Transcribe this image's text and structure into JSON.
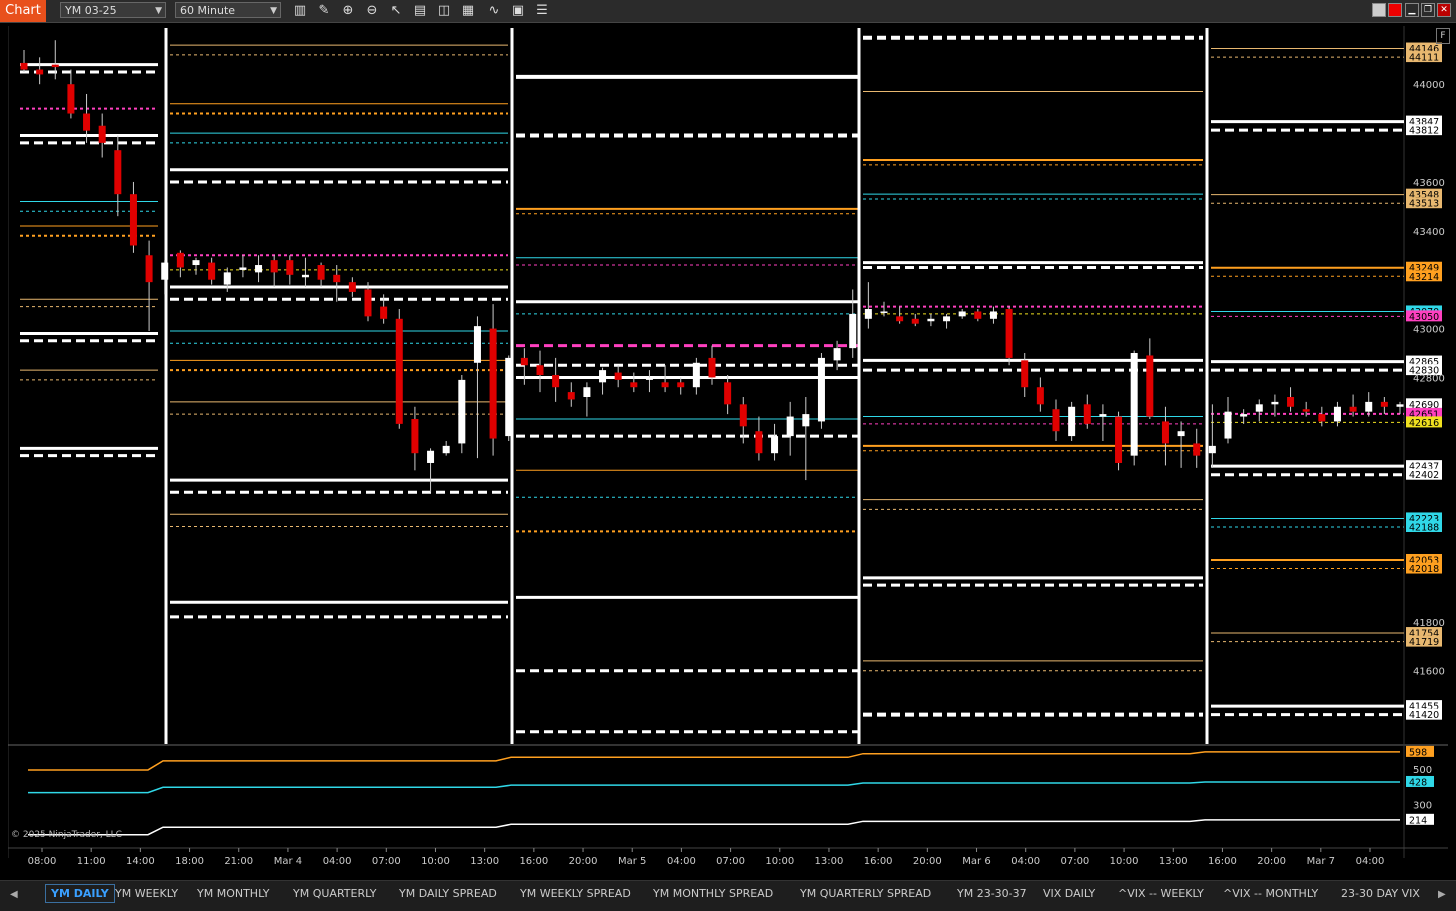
{
  "toolbar": {
    "chart_label": "Chart",
    "instrument": "YM 03-25",
    "interval": "60 Minute",
    "tools": [
      "bars-icon",
      "pencil-icon",
      "zoom-in-icon",
      "zoom-out-icon",
      "pointer-icon",
      "data-box-icon",
      "properties-icon",
      "templates-icon",
      "strategies-icon",
      "indicators-icon",
      "list-icon"
    ]
  },
  "panel_button": "F",
  "copyright": "© 2025 NinjaTrader, LLC",
  "chart_data": {
    "type": "candlestick",
    "instrument": "YM 03-25",
    "interval": "60 Minute",
    "ylim": [
      41300,
      44230
    ],
    "y_ticks": [
      44000,
      43600,
      43400,
      43000,
      42800,
      41800,
      41600
    ],
    "x_ticks": [
      "08:00",
      "11:00",
      "14:00",
      "18:00",
      "21:00",
      "Mar 4",
      "04:00",
      "07:00",
      "10:00",
      "13:00",
      "16:00",
      "20:00",
      "Mar 5",
      "04:00",
      "07:00",
      "10:00",
      "13:00",
      "16:00",
      "20:00",
      "Mar 6",
      "04:00",
      "07:00",
      "10:00",
      "13:00",
      "16:00",
      "20:00",
      "Mar 7",
      "04:00"
    ],
    "price_labels": [
      {
        "value": 44146,
        "color": "#e8b870"
      },
      {
        "value": 44111,
        "color": "#e8b870"
      },
      {
        "value": 43847,
        "color": "#ffffff"
      },
      {
        "value": 43812,
        "color": "#ffffff"
      },
      {
        "value": 43548,
        "color": "#e8b870"
      },
      {
        "value": 43513,
        "color": "#e8b870"
      },
      {
        "value": 43249,
        "color": "#ffa020"
      },
      {
        "value": 43214,
        "color": "#ffa020"
      },
      {
        "value": 43070,
        "color": "#30d8e8"
      },
      {
        "value": 43050,
        "color": "#ff40c0"
      },
      {
        "value": 42865,
        "color": "#ffffff"
      },
      {
        "value": 42830,
        "color": "#ffffff"
      },
      {
        "value": 42690,
        "color": "#ffffff"
      },
      {
        "value": 42651,
        "color": "#ff40c0"
      },
      {
        "value": 42616,
        "color": "#f0e020"
      },
      {
        "value": 42437,
        "color": "#ffffff"
      },
      {
        "value": 42402,
        "color": "#ffffff"
      },
      {
        "value": 42223,
        "color": "#30d8e8"
      },
      {
        "value": 42188,
        "color": "#30d8e8"
      },
      {
        "value": 42053,
        "color": "#ffa020"
      },
      {
        "value": 42018,
        "color": "#ffa020"
      },
      {
        "value": 41754,
        "color": "#e8b870"
      },
      {
        "value": 41719,
        "color": "#e8b870"
      },
      {
        "value": 41455,
        "color": "#ffffff"
      },
      {
        "value": 41420,
        "color": "#ffffff"
      }
    ],
    "candles": [
      {
        "o": 44087,
        "h": 44140,
        "l": 44050,
        "c": 44060
      },
      {
        "o": 44060,
        "h": 44110,
        "l": 44000,
        "c": 44040
      },
      {
        "o": 44080,
        "h": 44180,
        "l": 44020,
        "c": 44070
      },
      {
        "o": 44000,
        "h": 44060,
        "l": 43860,
        "c": 43880
      },
      {
        "o": 43880,
        "h": 43960,
        "l": 43760,
        "c": 43810
      },
      {
        "o": 43830,
        "h": 43880,
        "l": 43700,
        "c": 43760
      },
      {
        "o": 43730,
        "h": 43790,
        "l": 43460,
        "c": 43550
      },
      {
        "o": 43550,
        "h": 43600,
        "l": 43310,
        "c": 43340
      },
      {
        "o": 43300,
        "h": 43360,
        "l": 42990,
        "c": 43190
      },
      {
        "o": 43200,
        "h": 43280,
        "l": 43140,
        "c": 43270
      },
      {
        "o": 43310,
        "h": 43320,
        "l": 43210,
        "c": 43250
      },
      {
        "o": 43260,
        "h": 43290,
        "l": 43220,
        "c": 43280
      },
      {
        "o": 43270,
        "h": 43290,
        "l": 43180,
        "c": 43200
      },
      {
        "o": 43180,
        "h": 43250,
        "l": 43150,
        "c": 43230
      },
      {
        "o": 43240,
        "h": 43300,
        "l": 43210,
        "c": 43250
      },
      {
        "o": 43230,
        "h": 43300,
        "l": 43190,
        "c": 43260
      },
      {
        "o": 43280,
        "h": 43300,
        "l": 43170,
        "c": 43230
      },
      {
        "o": 43280,
        "h": 43300,
        "l": 43180,
        "c": 43220
      },
      {
        "o": 43210,
        "h": 43290,
        "l": 43170,
        "c": 43220
      },
      {
        "o": 43260,
        "h": 43270,
        "l": 43170,
        "c": 43200
      },
      {
        "o": 43220,
        "h": 43260,
        "l": 43110,
        "c": 43190
      },
      {
        "o": 43190,
        "h": 43210,
        "l": 43130,
        "c": 43150
      },
      {
        "o": 43160,
        "h": 43190,
        "l": 43030,
        "c": 43050
      },
      {
        "o": 43090,
        "h": 43140,
        "l": 43020,
        "c": 43040
      },
      {
        "o": 43040,
        "h": 43080,
        "l": 42590,
        "c": 42610
      },
      {
        "o": 42630,
        "h": 42680,
        "l": 42420,
        "c": 42490
      },
      {
        "o": 42450,
        "h": 42510,
        "l": 42330,
        "c": 42500
      },
      {
        "o": 42490,
        "h": 42540,
        "l": 42480,
        "c": 42520
      },
      {
        "o": 42530,
        "h": 42810,
        "l": 42490,
        "c": 42790
      },
      {
        "o": 42860,
        "h": 43050,
        "l": 42470,
        "c": 43010
      },
      {
        "o": 43000,
        "h": 43100,
        "l": 42480,
        "c": 42550
      },
      {
        "o": 42560,
        "h": 42890,
        "l": 42540,
        "c": 42880
      },
      {
        "o": 42880,
        "h": 42920,
        "l": 42770,
        "c": 42850
      },
      {
        "o": 42850,
        "h": 42910,
        "l": 42740,
        "c": 42810
      },
      {
        "o": 42810,
        "h": 42880,
        "l": 42700,
        "c": 42760
      },
      {
        "o": 42740,
        "h": 42780,
        "l": 42680,
        "c": 42710
      },
      {
        "o": 42720,
        "h": 42780,
        "l": 42640,
        "c": 42760
      },
      {
        "o": 42780,
        "h": 42840,
        "l": 42730,
        "c": 42830
      },
      {
        "o": 42820,
        "h": 42850,
        "l": 42760,
        "c": 42790
      },
      {
        "o": 42780,
        "h": 42820,
        "l": 42740,
        "c": 42760
      },
      {
        "o": 42790,
        "h": 42830,
        "l": 42740,
        "c": 42800
      },
      {
        "o": 42780,
        "h": 42850,
        "l": 42740,
        "c": 42760
      },
      {
        "o": 42780,
        "h": 42800,
        "l": 42730,
        "c": 42760
      },
      {
        "o": 42760,
        "h": 42880,
        "l": 42730,
        "c": 42860
      },
      {
        "o": 42880,
        "h": 42930,
        "l": 42770,
        "c": 42800
      },
      {
        "o": 42780,
        "h": 42810,
        "l": 42650,
        "c": 42690
      },
      {
        "o": 42690,
        "h": 42720,
        "l": 42530,
        "c": 42600
      },
      {
        "o": 42580,
        "h": 42640,
        "l": 42460,
        "c": 42490
      },
      {
        "o": 42490,
        "h": 42610,
        "l": 42460,
        "c": 42560
      },
      {
        "o": 42560,
        "h": 42700,
        "l": 42480,
        "c": 42640
      },
      {
        "o": 42600,
        "h": 42720,
        "l": 42380,
        "c": 42650
      },
      {
        "o": 42620,
        "h": 42900,
        "l": 42590,
        "c": 42880
      },
      {
        "o": 42870,
        "h": 42950,
        "l": 42830,
        "c": 42920
      },
      {
        "o": 42920,
        "h": 43160,
        "l": 42880,
        "c": 43060
      },
      {
        "o": 43040,
        "h": 43190,
        "l": 43000,
        "c": 43080
      },
      {
        "o": 43070,
        "h": 43110,
        "l": 43050,
        "c": 43070
      },
      {
        "o": 43050,
        "h": 43090,
        "l": 43020,
        "c": 43030
      },
      {
        "o": 43040,
        "h": 43060,
        "l": 43010,
        "c": 43020
      },
      {
        "o": 43030,
        "h": 43060,
        "l": 43010,
        "c": 43040
      },
      {
        "o": 43030,
        "h": 43060,
        "l": 43000,
        "c": 43050
      },
      {
        "o": 43050,
        "h": 43080,
        "l": 43040,
        "c": 43070
      },
      {
        "o": 43070,
        "h": 43080,
        "l": 43030,
        "c": 43040
      },
      {
        "o": 43040,
        "h": 43090,
        "l": 43020,
        "c": 43070
      },
      {
        "o": 43080,
        "h": 43090,
        "l": 42850,
        "c": 42880
      },
      {
        "o": 42870,
        "h": 42900,
        "l": 42720,
        "c": 42760
      },
      {
        "o": 42760,
        "h": 42800,
        "l": 42660,
        "c": 42690
      },
      {
        "o": 42670,
        "h": 42710,
        "l": 42540,
        "c": 42580
      },
      {
        "o": 42560,
        "h": 42700,
        "l": 42540,
        "c": 42680
      },
      {
        "o": 42690,
        "h": 42730,
        "l": 42590,
        "c": 42610
      },
      {
        "o": 42640,
        "h": 42690,
        "l": 42540,
        "c": 42650
      },
      {
        "o": 42640,
        "h": 42660,
        "l": 42420,
        "c": 42450
      },
      {
        "o": 42480,
        "h": 42910,
        "l": 42440,
        "c": 42900
      },
      {
        "o": 42890,
        "h": 42960,
        "l": 42630,
        "c": 42640
      },
      {
        "o": 42620,
        "h": 42680,
        "l": 42440,
        "c": 42530
      },
      {
        "o": 42560,
        "h": 42620,
        "l": 42430,
        "c": 42580
      },
      {
        "o": 42530,
        "h": 42590,
        "l": 42430,
        "c": 42480
      },
      {
        "o": 42490,
        "h": 42690,
        "l": 42430,
        "c": 42520
      },
      {
        "o": 42550,
        "h": 42720,
        "l": 42530,
        "c": 42660
      },
      {
        "o": 42640,
        "h": 42670,
        "l": 42610,
        "c": 42650
      },
      {
        "o": 42660,
        "h": 42710,
        "l": 42620,
        "c": 42690
      },
      {
        "o": 42690,
        "h": 42730,
        "l": 42640,
        "c": 42700
      },
      {
        "o": 42720,
        "h": 42760,
        "l": 42660,
        "c": 42680
      },
      {
        "o": 42670,
        "h": 42700,
        "l": 42640,
        "c": 42660
      },
      {
        "o": 42650,
        "h": 42680,
        "l": 42600,
        "c": 42620
      },
      {
        "o": 42620,
        "h": 42700,
        "l": 42600,
        "c": 42680
      },
      {
        "o": 42680,
        "h": 42730,
        "l": 42640,
        "c": 42660
      },
      {
        "o": 42660,
        "h": 42740,
        "l": 42640,
        "c": 42700
      },
      {
        "o": 42700,
        "h": 42720,
        "l": 42650,
        "c": 42680
      },
      {
        "o": 42680,
        "h": 42700,
        "l": 42650,
        "c": 42690
      }
    ],
    "lower_panel": {
      "y_ticks": [
        500,
        300
      ],
      "series": [
        {
          "color": "#ffa020",
          "values": [
            496,
            496,
            598
          ],
          "label": 598
        },
        {
          "color": "#30d8e8",
          "values": [
            368,
            368,
            428
          ],
          "label": 428
        },
        {
          "color": "#ffffff",
          "values": [
            130,
            130,
            214
          ],
          "label": 214
        }
      ]
    }
  },
  "tabs": [
    "YM DAILY",
    "YM WEEKLY",
    "YM MONTHLY",
    "YM QUARTERLY",
    "YM DAILY SPREAD",
    "YM WEEKLY SPREAD",
    "YM MONTHLY SPREAD",
    "YM QUARTERLY SPREAD",
    "YM 23-30-37",
    "VIX DAILY",
    "^VIX -- WEEKLY",
    "^VIX -- MONTHLY",
    "23-30 DAY VIX"
  ],
  "colors": {
    "bull": "#ffffff",
    "bear": "#e00000",
    "background": "#000000",
    "accent": "#e8501c"
  }
}
